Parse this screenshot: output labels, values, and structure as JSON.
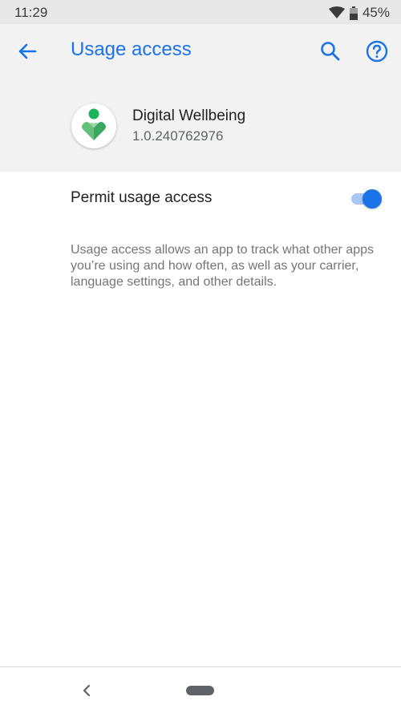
{
  "status_bar": {
    "time": "11:29",
    "battery": "45%",
    "icons": [
      "wifi-icon",
      "battery-icon"
    ]
  },
  "app_bar": {
    "title": "Usage access",
    "icons": [
      "back-arrow-icon",
      "search-icon",
      "help-icon"
    ]
  },
  "app_info": {
    "name": "Digital Wellbeing",
    "version": "1.0.240762976",
    "icon": "digital-wellbeing-icon"
  },
  "setting": {
    "label": "Permit usage access",
    "enabled": true
  },
  "description": "Usage access allows an app to track what other apps you’re using and how often, as well as your carrier, language settings, and other details.",
  "nav_bar": {
    "icons": [
      "nav-back-icon",
      "nav-home-pill"
    ]
  },
  "colors": {
    "accent": "#1a73e8",
    "header_bg": "#f2f2f2",
    "status_bg": "#e8e8e8"
  }
}
